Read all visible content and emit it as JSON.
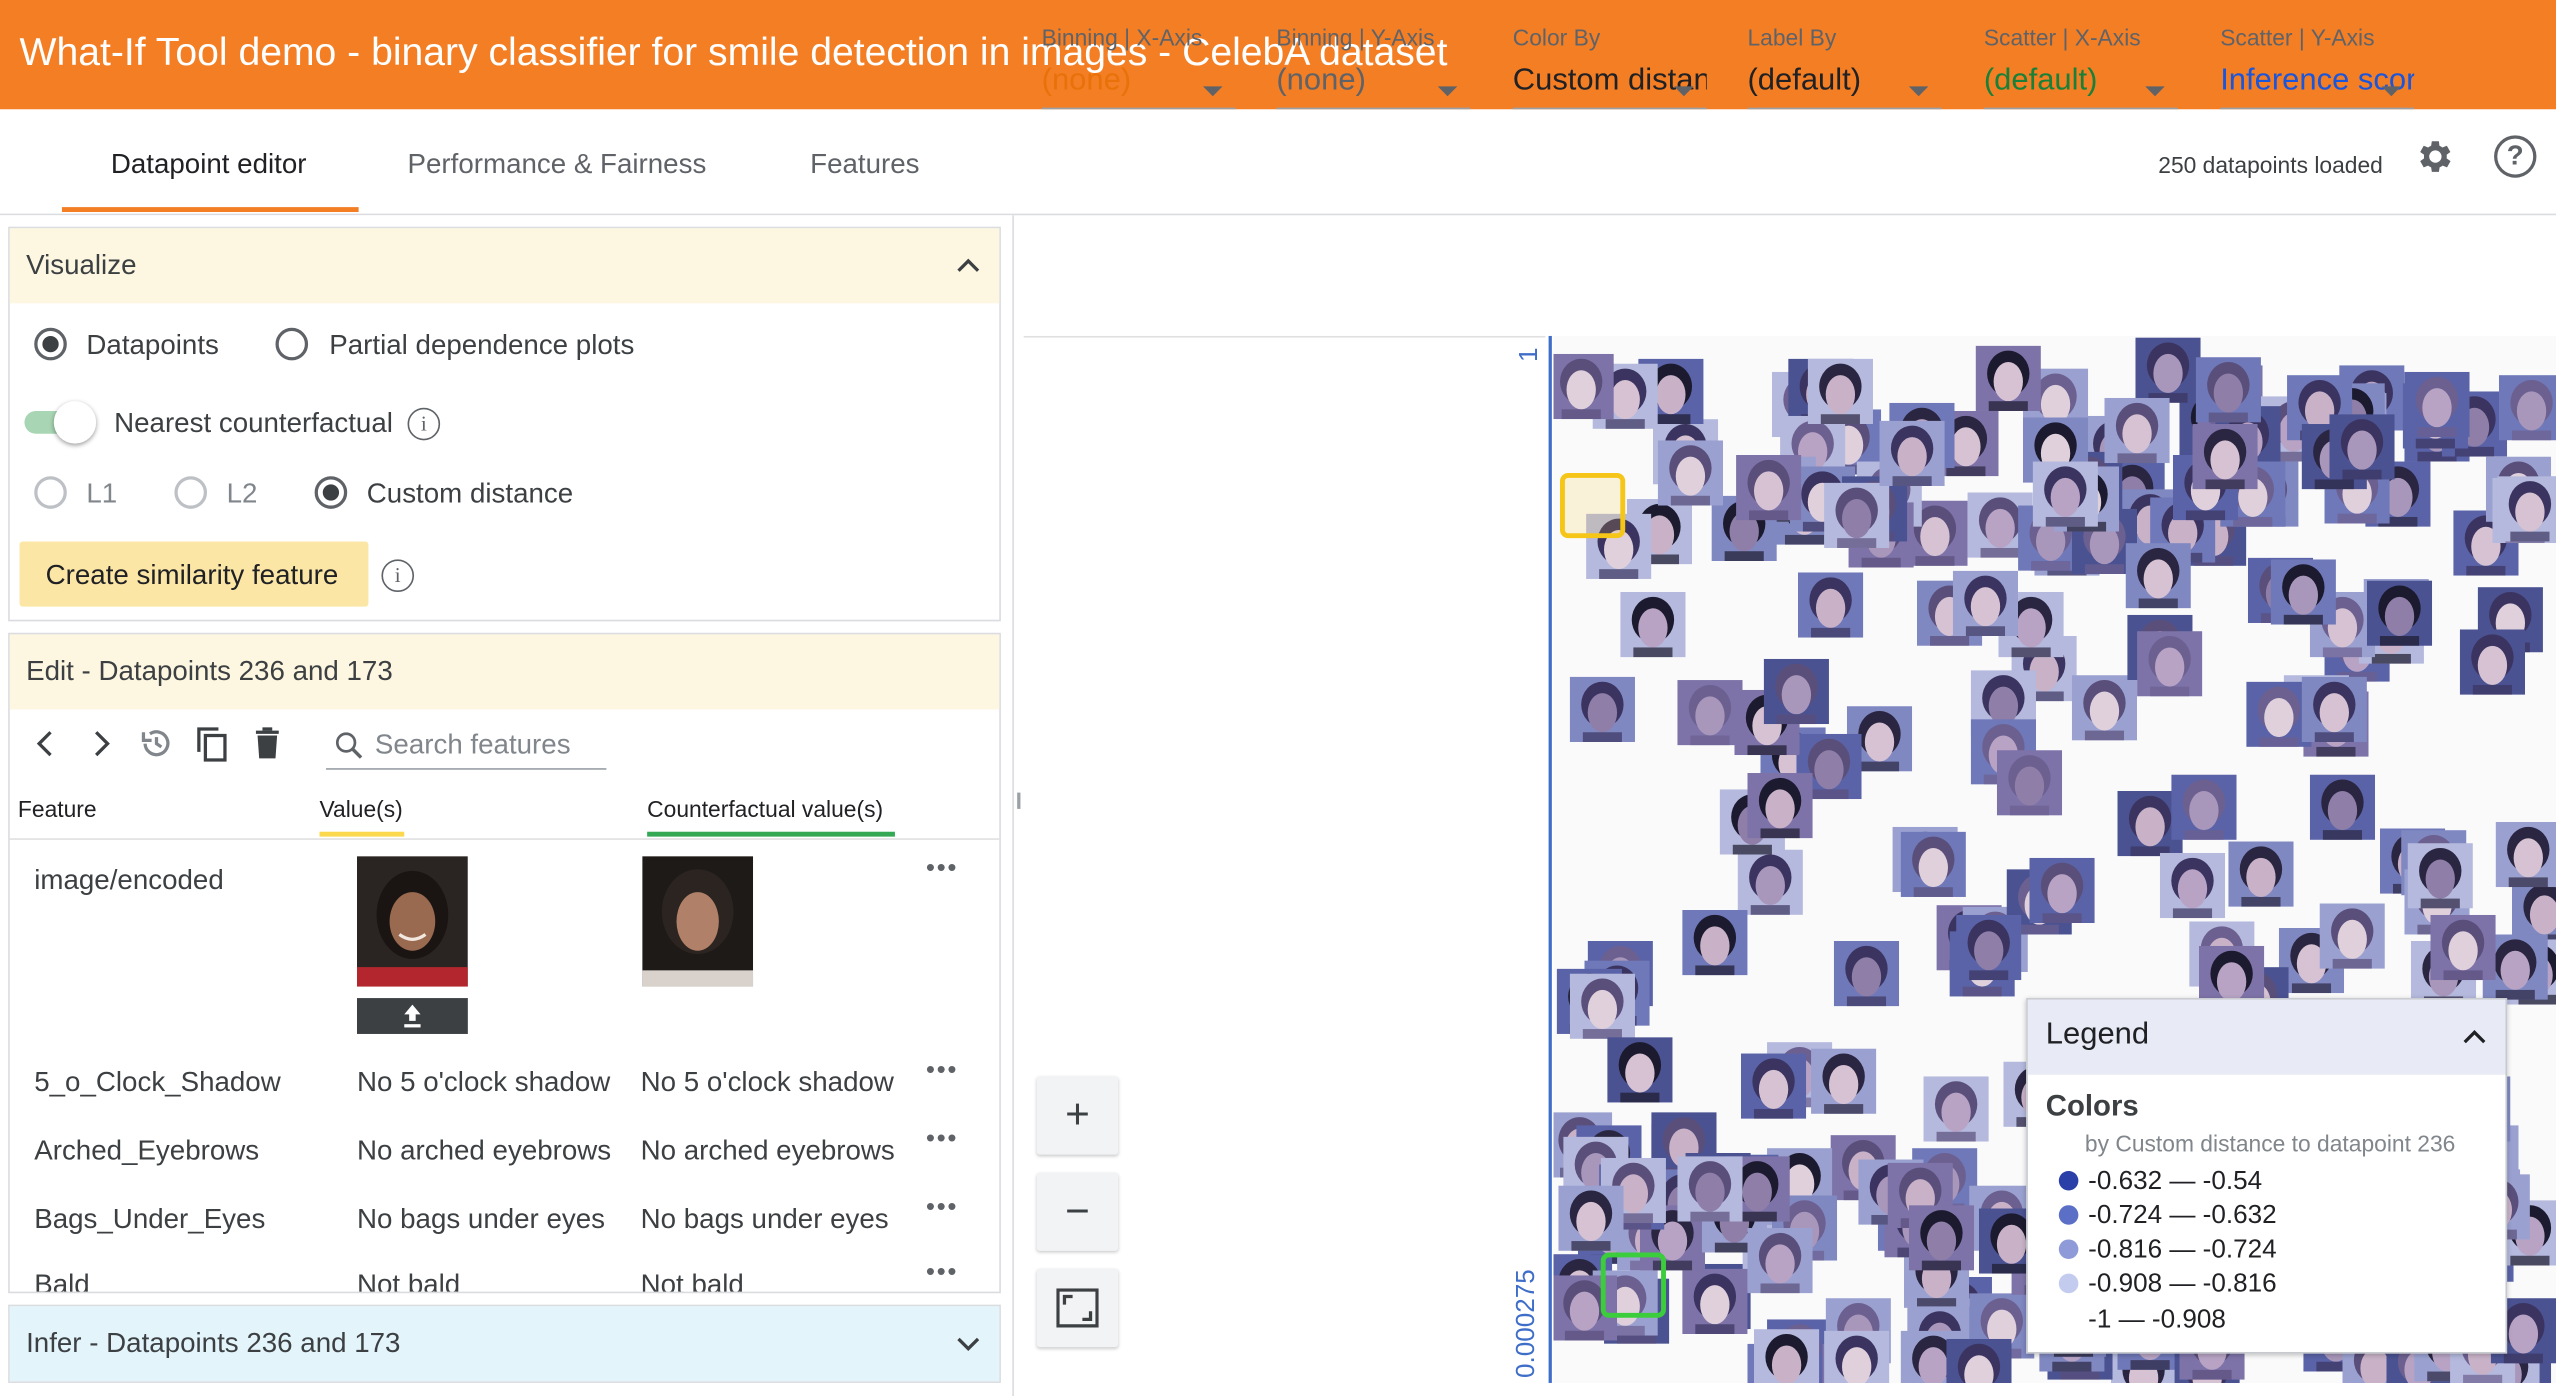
{
  "app": {
    "title": "What-If Tool demo - binary classifier for smile detection in images - CelebA dataset",
    "accent": "#f47e24"
  },
  "tabs": [
    "Datapoint editor",
    "Performance & Fairness",
    "Features"
  ],
  "status": {
    "loaded": "250 datapoints loaded"
  },
  "visualize": {
    "title": "Visualize",
    "mode_datapoints": "Datapoints",
    "mode_pdp": "Partial dependence plots",
    "nearest_counterfactual": "Nearest counterfactual",
    "dist_l1": "L1",
    "dist_l2": "L2",
    "dist_custom": "Custom distance",
    "similarity_button": "Create similarity feature"
  },
  "edit": {
    "title": "Edit - Datapoints 236 and 173",
    "search_placeholder": "Search features",
    "col_feature": "Feature",
    "col_values": "Value(s)",
    "col_counterfactual": "Counterfactual value(s)",
    "rows": [
      {
        "feature": "image/encoded",
        "value": "",
        "counterfactual": ""
      },
      {
        "feature": "5_o_Clock_Shadow",
        "value": "No 5 o'clock shadow",
        "counterfactual": "No 5 o'clock shadow"
      },
      {
        "feature": "Arched_Eyebrows",
        "value": "No arched eyebrows",
        "counterfactual": "No arched eyebrows"
      },
      {
        "feature": "Bags_Under_Eyes",
        "value": "No bags under eyes",
        "counterfactual": "No bags under eyes"
      },
      {
        "feature": "Bald",
        "value": "Not bald",
        "counterfactual": "Not bald"
      }
    ]
  },
  "infer": {
    "title": "Infer - Datapoints 236 and 173"
  },
  "controls": [
    {
      "label": "Binning | X-Axis",
      "value": "(none)",
      "color": "#e8710a"
    },
    {
      "label": "Binning | Y-Axis",
      "value": "(none)",
      "color": "#5f6368"
    },
    {
      "label": "Color By",
      "value": "Custom distance",
      "color": "#202124"
    },
    {
      "label": "Label By",
      "value": "(default)",
      "color": "#202124"
    },
    {
      "label": "Scatter | X-Axis",
      "value": "(default)",
      "color": "#188038"
    },
    {
      "label": "Scatter | Y-Axis",
      "value": "Inference score",
      "color": "#1a56db"
    }
  ],
  "plot": {
    "y_top_tick": "1",
    "y_bottom_tick": "0.000275"
  },
  "legend": {
    "title": "Legend",
    "section": "Colors",
    "subtitle": "by Custom distance to datapoint 236",
    "items": [
      {
        "range": "-0.632 — -0.54",
        "color": "#2b3fa8"
      },
      {
        "range": "-0.724 — -0.632",
        "color": "#5b6fc6"
      },
      {
        "range": "-0.816 — -0.724",
        "color": "#8f9bd9"
      },
      {
        "range": "-0.908 — -0.816",
        "color": "#c3cbef"
      },
      {
        "range": "-1 — -0.908",
        "color": "#ffffff"
      }
    ]
  }
}
